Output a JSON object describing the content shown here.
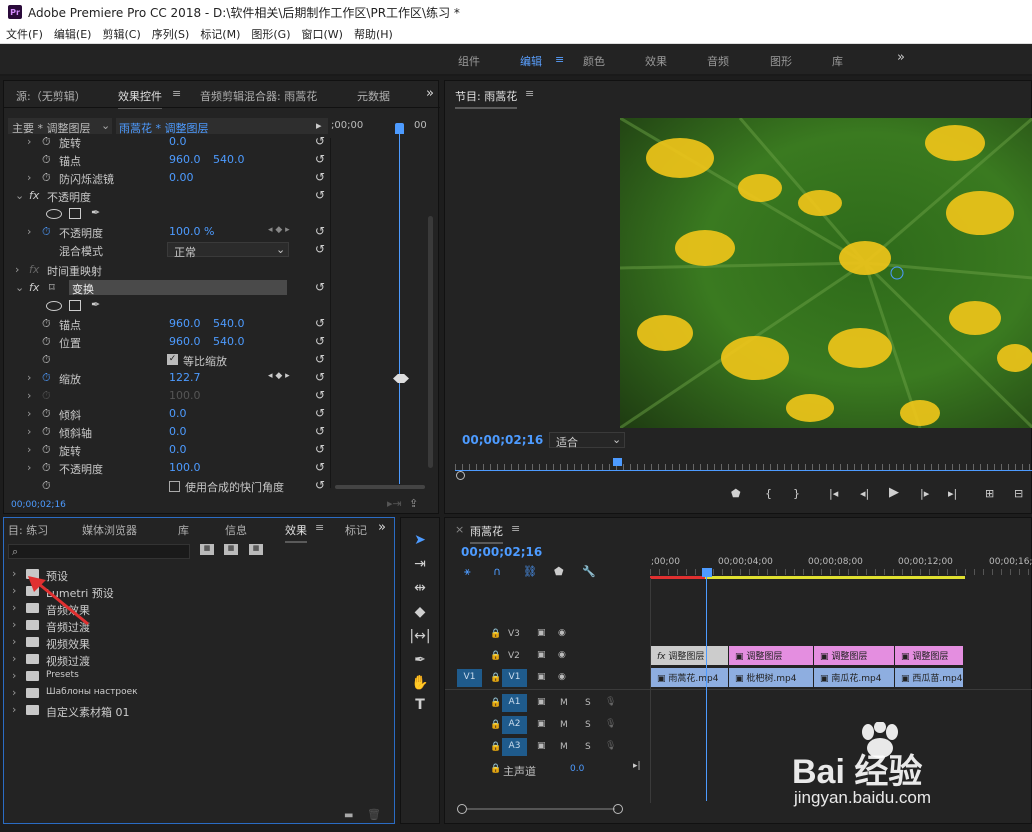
{
  "app": {
    "title": "Adobe Premiere Pro CC 2018 - D:\\软件相关\\后期制作工作区\\PR工作区\\练习 *",
    "logo": "Pr"
  },
  "menu": [
    "文件(F)",
    "编辑(E)",
    "剪辑(C)",
    "序列(S)",
    "标记(M)",
    "图形(G)",
    "窗口(W)",
    "帮助(H)"
  ],
  "workspaces": [
    "组件",
    "编辑",
    "颜色",
    "效果",
    "音频",
    "图形",
    "库"
  ],
  "workspaces_more": "»",
  "effect_controls": {
    "tab_source": "源:（无剪辑）",
    "tab_effect": "效果控件",
    "tab_mixer": "音频剪辑混合器: 雨蒿花",
    "tab_meta": "元数据",
    "master": "主要 * 调整图层",
    "clip": "雨蒿花 * 调整图层",
    "ruler_time": ";00;00",
    "ruler_time2": "00",
    "timecode": "00;00;02;16",
    "rows": {
      "rotate1": "旋转",
      "rotate1_v": "0.0",
      "anchor1": "锚点",
      "anchor1_x": "960.0",
      "anchor1_y": "540.0",
      "flicker": "防闪烁滤镜",
      "flicker_v": "0.00",
      "opacity_fx": "不透明度",
      "opacity": "不透明度",
      "opacity_v": "100.0 %",
      "blend": "混合模式",
      "blend_v": "正常",
      "timeremap": "时间重映射",
      "transform": "变换",
      "anchor2": "锚点",
      "anchor2_x": "960.0",
      "anchor2_y": "540.0",
      "position": "位置",
      "position_x": "960.0",
      "position_y": "540.0",
      "uniform": "等比缩放",
      "scale": "缩放",
      "scale_v": "122.7",
      "dim_v": "100.0",
      "skew": "倾斜",
      "skew_v": "0.0",
      "skewaxis": "倾斜轴",
      "skewaxis_v": "0.0",
      "rotate2": "旋转",
      "rotate2_v": "0.0",
      "opacity2": "不透明度",
      "opacity2_v": "100.0",
      "shutter": "使用合成的快门角度"
    }
  },
  "program": {
    "title": "节目: 雨蒿花",
    "timecode": "00;00;02;16",
    "fit": "适合"
  },
  "project": {
    "tabs": [
      "目: 练习",
      "媒体浏览器",
      "库",
      "信息",
      "效果",
      "标记"
    ],
    "search_placeholder": "",
    "items": [
      "预设",
      "Lumetri 预设",
      "音频效果",
      "音频过渡",
      "视频效果",
      "视频过渡",
      "Presets",
      "Шаблоны настроек",
      "自定义素材箱 01"
    ]
  },
  "timeline": {
    "tab": "雨蒿花",
    "timecode": "00;00;02;16",
    "ruler": [
      ";00;00",
      "00;00;04;00",
      "00;00;08;00",
      "00;00;12;00",
      "00;00;16;0"
    ],
    "tracks": {
      "v3": "V3",
      "v2": "V2",
      "v1": "V1",
      "src": "V1",
      "a1": "A1",
      "a2": "A2",
      "a3": "A3",
      "m": "M",
      "s": "S"
    },
    "master": "主声道",
    "master_v": "0.0",
    "v2_clips": [
      "调整图层",
      "调整图层",
      "调整图层",
      "调整图层"
    ],
    "v1_clips": [
      "雨蒿花.mp4",
      "枇杷树.mp4",
      "南瓜花.mp4",
      "西瓜苗.mp4"
    ]
  },
  "watermark": {
    "brand": "Bai 经验",
    "url": "jingyan.baidu.com"
  },
  "colors": {
    "accent": "#4d9bff",
    "panel": "#232323",
    "pink_clip": "#e48ee0",
    "blue_clip": "#8eaee0",
    "arrow": "#e03030"
  }
}
